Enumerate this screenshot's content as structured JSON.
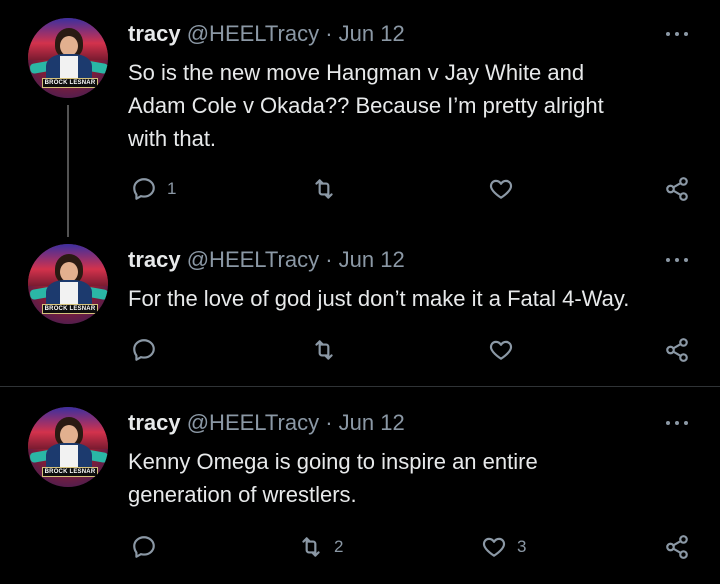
{
  "tweets": [
    {
      "name": "tracy",
      "handle": "@HEELTracy",
      "separator": "·",
      "date": "Jun 12",
      "lines": [
        "So is the new move Hangman v Jay White and",
        "Adam Cole v Okada?? Because I’m pretty alright",
        "with that."
      ],
      "reply_count": "1",
      "retweet_count": "",
      "like_count": ""
    },
    {
      "name": "tracy",
      "handle": "@HEELTracy",
      "separator": "·",
      "date": "Jun 12",
      "lines": [
        "For the love of god just don’t make it a Fatal 4-Way."
      ],
      "reply_count": "",
      "retweet_count": "",
      "like_count": ""
    },
    {
      "name": "tracy",
      "handle": "@HEELTracy",
      "separator": "·",
      "date": "Jun 12",
      "lines": [
        "Kenny Omega is going to inspire an entire",
        "generation of wrestlers."
      ],
      "reply_count": "",
      "retweet_count": "2",
      "like_count": "3"
    }
  ],
  "avatar_banner_text": "BROCK LESNAR",
  "icons": {
    "reply": "reply-icon",
    "retweet": "retweet-icon",
    "like": "heart-icon",
    "share": "share-icon",
    "more": "more-icon"
  },
  "colors": {
    "background": "#000000",
    "text": "#e7e9ea",
    "secondary": "#8b98a5",
    "divider": "#2f3336"
  }
}
